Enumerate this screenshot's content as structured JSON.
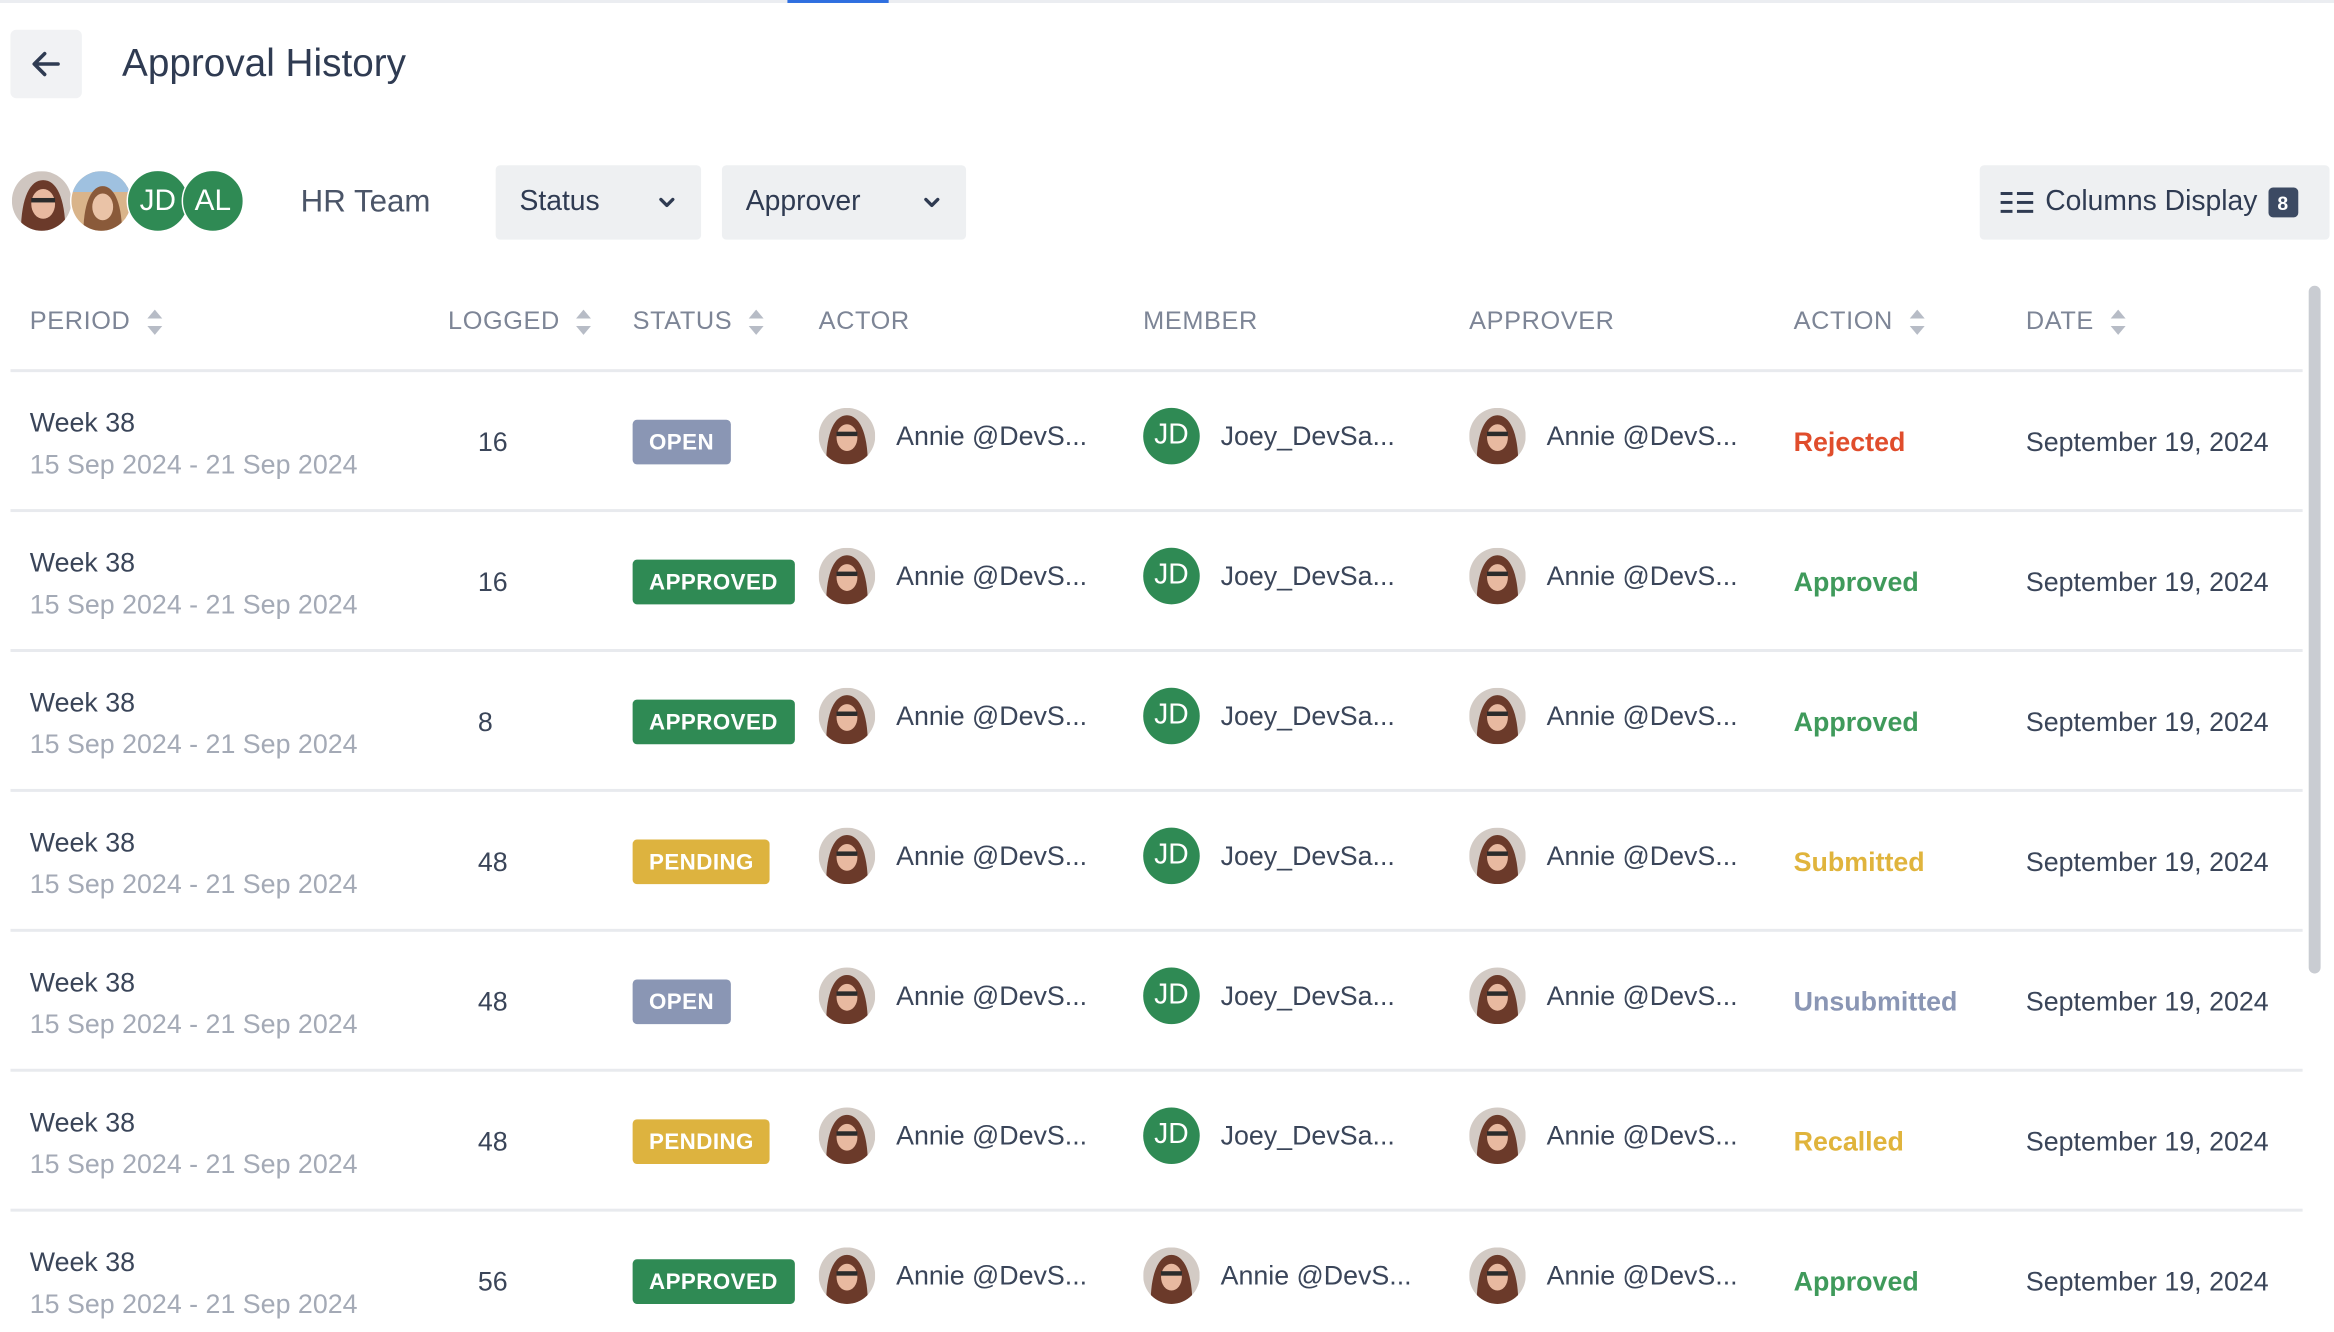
{
  "page": {
    "title": "Approval History"
  },
  "team": {
    "name": "HR Team",
    "members": [
      {
        "type": "photo"
      },
      {
        "type": "photo"
      },
      {
        "type": "initials",
        "initials": "JD"
      },
      {
        "type": "initials",
        "initials": "AL"
      }
    ]
  },
  "filters": {
    "status_label": "Status",
    "approver_label": "Approver"
  },
  "columns_display": {
    "label": "Columns Display",
    "count": "8"
  },
  "table": {
    "headers": {
      "period": "PERIOD",
      "logged": "LOGGED",
      "status": "STATUS",
      "actor": "ACTOR",
      "member": "MEMBER",
      "approver": "APPROVER",
      "action": "ACTION",
      "date": "DATE"
    },
    "rows": [
      {
        "week": "Week 38",
        "range": "15 Sep 2024 - 21 Sep 2024",
        "logged": "16",
        "status": "OPEN",
        "actor": "Annie @DevS...",
        "member": "Joey_DevSa...",
        "member_initials": "JD",
        "approver": "Annie @DevS...",
        "action": "Rejected",
        "date": "September 19, 2024"
      },
      {
        "week": "Week 38",
        "range": "15 Sep 2024 - 21 Sep 2024",
        "logged": "16",
        "status": "APPROVED",
        "actor": "Annie @DevS...",
        "member": "Joey_DevSa...",
        "member_initials": "JD",
        "approver": "Annie @DevS...",
        "action": "Approved",
        "date": "September 19, 2024"
      },
      {
        "week": "Week 38",
        "range": "15 Sep 2024 - 21 Sep 2024",
        "logged": "8",
        "status": "APPROVED",
        "actor": "Annie @DevS...",
        "member": "Joey_DevSa...",
        "member_initials": "JD",
        "approver": "Annie @DevS...",
        "action": "Approved",
        "date": "September 19, 2024"
      },
      {
        "week": "Week 38",
        "range": "15 Sep 2024 - 21 Sep 2024",
        "logged": "48",
        "status": "PENDING",
        "actor": "Annie @DevS...",
        "member": "Joey_DevSa...",
        "member_initials": "JD",
        "approver": "Annie @DevS...",
        "action": "Submitted",
        "date": "September 19, 2024"
      },
      {
        "week": "Week 38",
        "range": "15 Sep 2024 - 21 Sep 2024",
        "logged": "48",
        "status": "OPEN",
        "actor": "Annie @DevS...",
        "member": "Joey_DevSa...",
        "member_initials": "JD",
        "approver": "Annie @DevS...",
        "action": "Unsubmitted",
        "date": "September 19, 2024"
      },
      {
        "week": "Week 38",
        "range": "15 Sep 2024 - 21 Sep 2024",
        "logged": "48",
        "status": "PENDING",
        "actor": "Annie @DevS...",
        "member": "Joey_DevSa...",
        "member_initials": "JD",
        "approver": "Annie @DevS...",
        "action": "Recalled",
        "date": "September 19, 2024"
      },
      {
        "week": "Week 38",
        "range": "15 Sep 2024 - 21 Sep 2024",
        "logged": "56",
        "status": "APPROVED",
        "actor": "Annie @DevS...",
        "member": "Annie @DevS...",
        "member_initials": "",
        "approver": "Annie @DevS...",
        "action": "Approved",
        "date": "September 19, 2024"
      }
    ]
  },
  "colors": {
    "status_open": "#8a96b4",
    "status_approved": "#2f8a54",
    "status_pending": "#ddb33f",
    "action_rejected": "#e04d2c",
    "action_approved": "#3f9a5b",
    "action_submitted": "#e0b43c",
    "action_unsubmitted": "#8a96b4",
    "action_recalled": "#e0b43c",
    "avatar_green": "#2f8a54",
    "accent_blue": "#2f6fe0"
  },
  "icons": {
    "back": "arrow-left-icon",
    "dropdown": "chevron-down-icon",
    "columns": "columns-list-icon",
    "sort": "sort-updown-icon"
  }
}
